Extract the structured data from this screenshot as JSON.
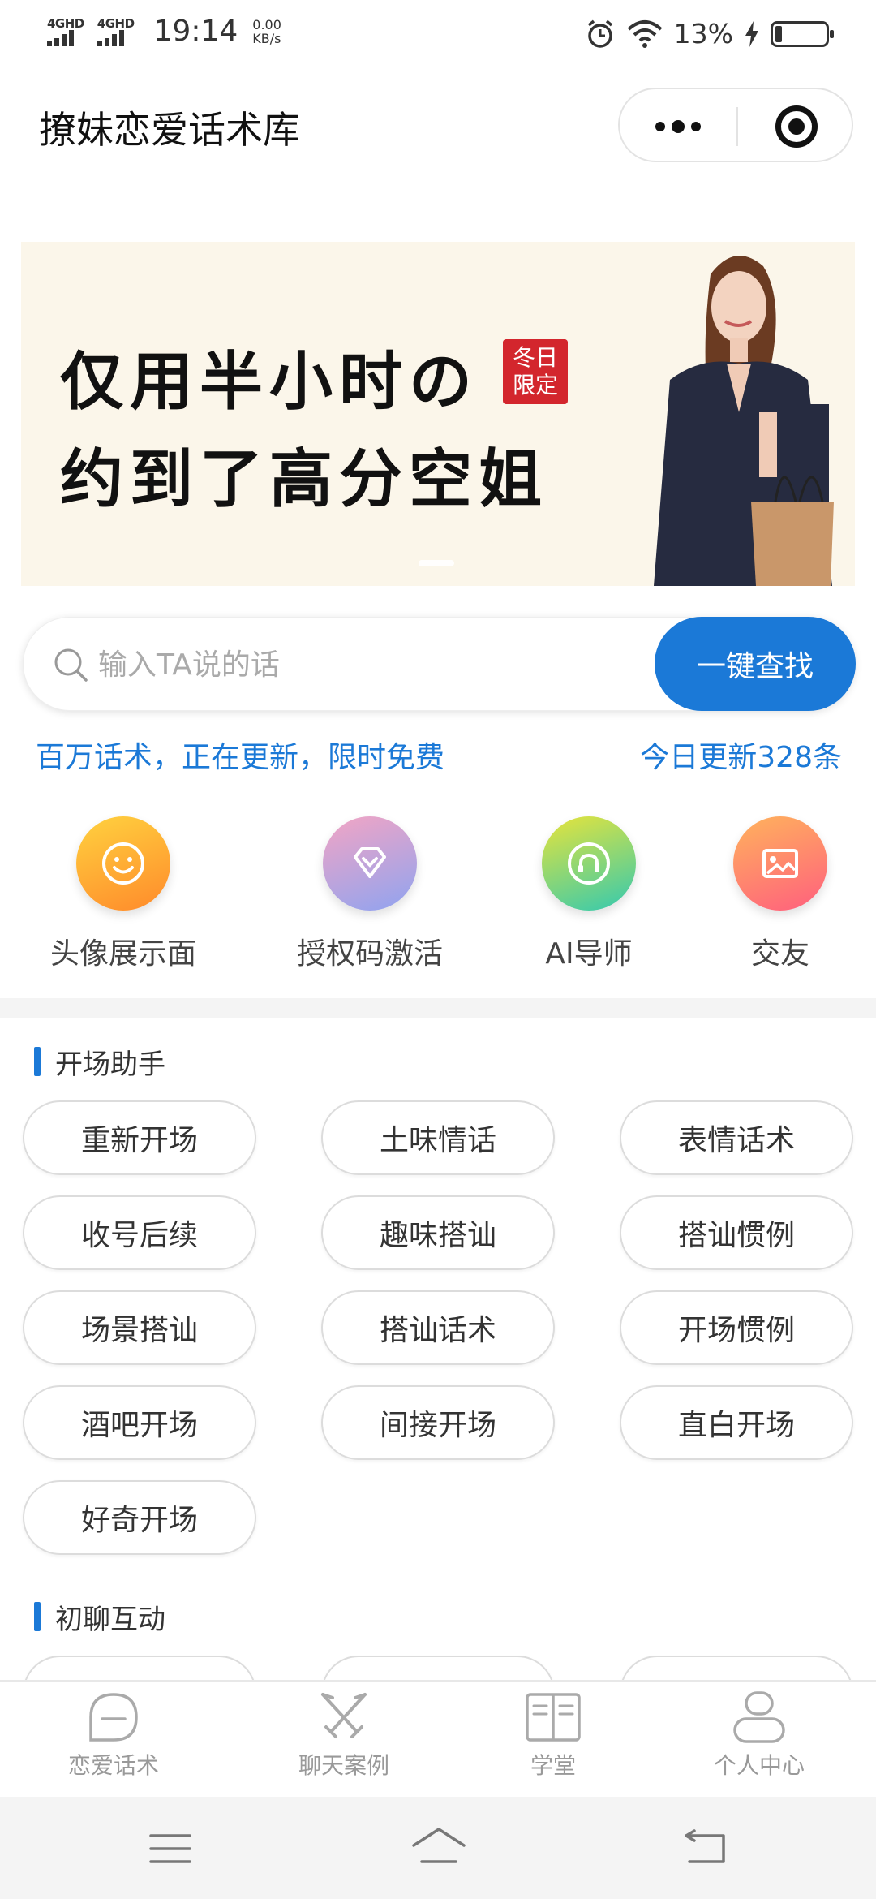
{
  "status_bar": {
    "signal1_label": "4GHD",
    "signal2_label": "4GHD",
    "time": "19:14",
    "speed_value": "0.00",
    "speed_unit": "KB/s",
    "battery": "13%"
  },
  "nav": {
    "title": "撩妹恋爱话术库"
  },
  "banner": {
    "line1": "仅用半小时の",
    "line2": "约到了高分空姐",
    "seal_text1": "冬日",
    "seal_text2": "限定"
  },
  "search": {
    "placeholder": "输入TA说的话",
    "button_label": "一键查找"
  },
  "promo": {
    "left": "百万话术，正在更新，限时免费",
    "right": "今日更新328条"
  },
  "quick_entries": [
    {
      "label": "头像展示面",
      "icon": "smile-icon"
    },
    {
      "label": "授权码激活",
      "icon": "diamond-icon"
    },
    {
      "label": "AI导师",
      "icon": "headset-icon"
    },
    {
      "label": "交友",
      "icon": "image-icon"
    }
  ],
  "sections": [
    {
      "title": "开场助手",
      "tags": [
        "重新开场",
        "土味情话",
        "表情话术",
        "收号后续",
        "趣味搭讪",
        "搭讪惯例",
        "场景搭讪",
        "搭讪话术",
        "开场惯例",
        "酒吧开场",
        "间接开场",
        "直白开场",
        "好奇开场"
      ]
    },
    {
      "title": "初聊互动"
    }
  ],
  "tabbar": [
    {
      "label": "恋爱话术",
      "icon": "chat-bubble-icon"
    },
    {
      "label": "聊天案例",
      "icon": "swords-icon"
    },
    {
      "label": "学堂",
      "icon": "book-icon"
    },
    {
      "label": "个人中心",
      "icon": "user-icon"
    }
  ],
  "colors": {
    "accent": "#1b79d7",
    "banner_bg": "#fbf6ea",
    "seal": "#d3262d"
  }
}
